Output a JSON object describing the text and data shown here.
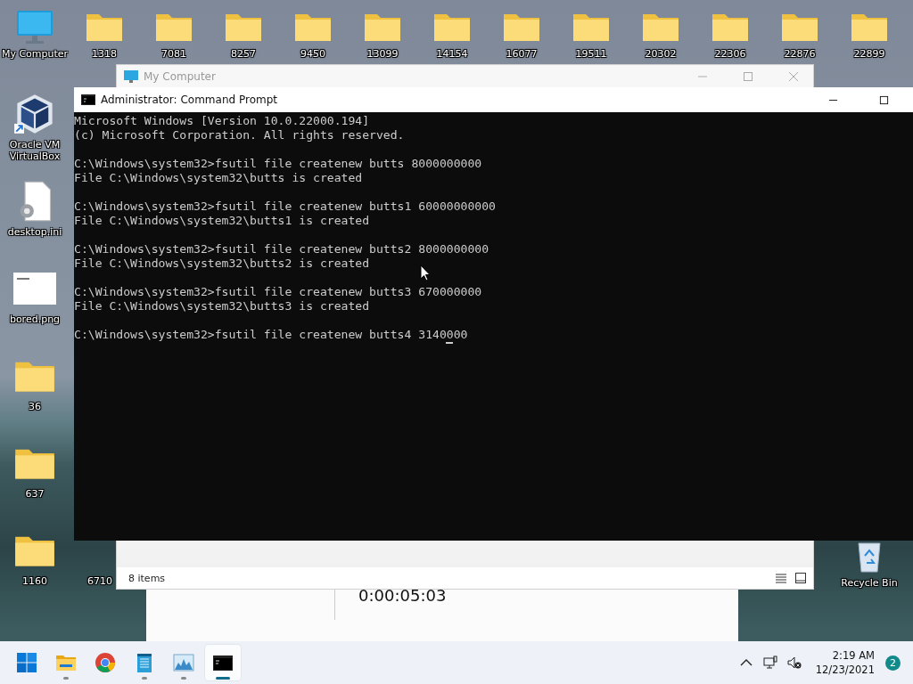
{
  "desktop": {
    "top_icons": [
      {
        "kind": "computer",
        "label": "My Computer"
      },
      {
        "kind": "folder",
        "label": "1318"
      },
      {
        "kind": "folder",
        "label": "7081"
      },
      {
        "kind": "folder",
        "label": "8257"
      },
      {
        "kind": "folder",
        "label": "9450"
      },
      {
        "kind": "folder",
        "label": "13099"
      },
      {
        "kind": "folder",
        "label": "14154"
      },
      {
        "kind": "folder",
        "label": "16077"
      },
      {
        "kind": "folder",
        "label": "19511"
      },
      {
        "kind": "folder",
        "label": "20302"
      },
      {
        "kind": "folder",
        "label": "22306"
      },
      {
        "kind": "folder",
        "label": "22876"
      },
      {
        "kind": "folder",
        "label": "22899"
      }
    ],
    "left_icons": [
      {
        "kind": "virtualbox",
        "label": "Oracle VM VirtualBox"
      },
      {
        "kind": "file",
        "label": "desktop.ini"
      },
      {
        "kind": "image",
        "label": "bored.png"
      },
      {
        "kind": "folder",
        "label": "36"
      },
      {
        "kind": "folder",
        "label": "637"
      },
      {
        "kind": "folder",
        "label": "1160"
      }
    ],
    "partial_icon_label": "6710",
    "recycle_bin": {
      "label": "Recycle Bin"
    }
  },
  "back_window": {
    "timer": "0:00:05:03"
  },
  "explorer_window": {
    "title": "My Computer",
    "status": "8 items"
  },
  "cmd_window": {
    "title": "Administrator: Command Prompt",
    "header": [
      "Microsoft Windows [Version 10.0.22000.194]",
      "(c) Microsoft Corporation. All rights reserved."
    ],
    "entries": [
      {
        "command": "C:\\Windows\\system32>fsutil file createnew butts 8000000000",
        "output": "File C:\\Windows\\system32\\butts is created"
      },
      {
        "command": "C:\\Windows\\system32>fsutil file createnew butts1 60000000000",
        "output": "File C:\\Windows\\system32\\butts1 is created"
      },
      {
        "command": "C:\\Windows\\system32>fsutil file createnew butts2 8000000000",
        "output": "File C:\\Windows\\system32\\butts2 is created"
      },
      {
        "command": "C:\\Windows\\system32>fsutil file createnew butts3 670000000",
        "output": "File C:\\Windows\\system32\\butts3 is created"
      }
    ],
    "prompt": "C:\\Windows\\system32>fsutil file createnew butts4 3140000"
  },
  "taskbar": {
    "apps": [
      {
        "kind": "start",
        "selected": false,
        "running": false
      },
      {
        "kind": "explorer",
        "selected": false,
        "running": true
      },
      {
        "kind": "chrome",
        "selected": false,
        "running": false
      },
      {
        "kind": "notepad",
        "selected": false,
        "running": true
      },
      {
        "kind": "monitor",
        "selected": false,
        "running": true
      },
      {
        "kind": "terminal",
        "selected": true,
        "running": true
      }
    ],
    "time": "2:19 AM",
    "date": "12/23/2021",
    "notifications": "2"
  }
}
